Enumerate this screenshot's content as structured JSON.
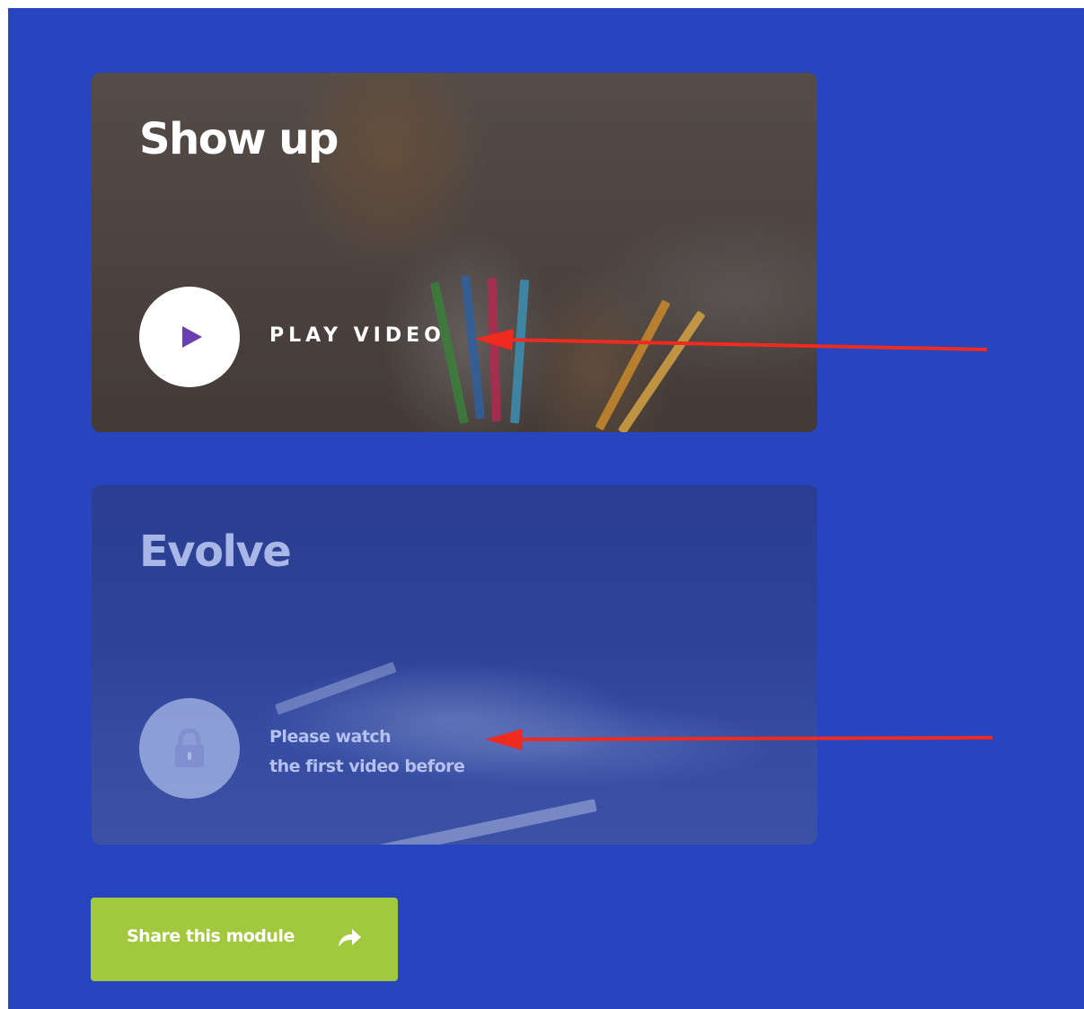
{
  "modules": [
    {
      "title": "Show up",
      "action_label": "PLAY VIDEO",
      "state": "unlocked",
      "icon": "play-icon"
    },
    {
      "title": "Evolve",
      "lock_message_line1": "Please watch",
      "lock_message_line2": "the first video before",
      "state": "locked",
      "icon": "lock-icon"
    }
  ],
  "share": {
    "label": "Share this module",
    "icon": "share-arrow-icon"
  },
  "colors": {
    "background": "#2645bf",
    "share_button": "#a2c83d",
    "play_accent": "#6a3fb0",
    "annotation_arrow": "#ee2b1e"
  }
}
